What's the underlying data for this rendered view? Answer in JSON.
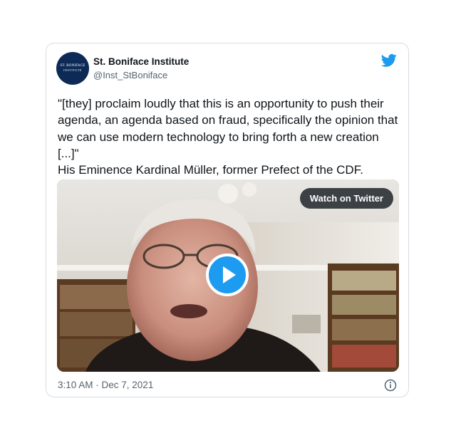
{
  "tweet": {
    "avatar": {
      "line1": "ST. BONIFACE",
      "line2": "INSTITUTE"
    },
    "display_name": "St. Boniface Institute",
    "handle": "@Inst_StBoniface",
    "text": "\"[they] proclaim loudly that this is an opportunity to push their agenda, an agenda based on fraud, specifically the opinion that we can use modern technology to bring forth a new creation [...]\"\nHis Eminence Kardinal Müller, former Prefect of the CDF.",
    "media": {
      "watch_label": "Watch on Twitter"
    },
    "timestamp": "3:10 AM · Dec 7, 2021"
  },
  "icons": {
    "brand_logo": "twitter-bird-icon",
    "play": "play-icon",
    "info": "info-icon"
  },
  "colors": {
    "twitter_blue": "#1d9bf0",
    "text_primary": "#0f1419",
    "text_secondary": "#536471",
    "border": "#d6dde3",
    "avatar_bg": "#0d2a57"
  }
}
